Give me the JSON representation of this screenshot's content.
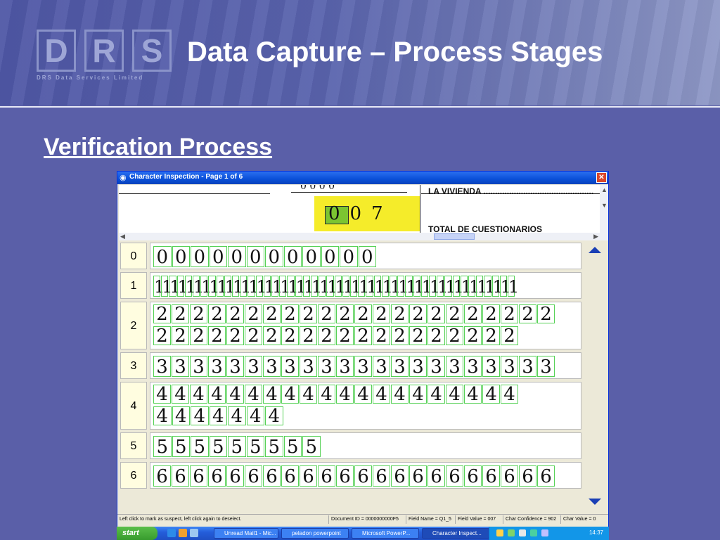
{
  "slide": {
    "title": "Data Capture – Process Stages",
    "subtitle": "Verification Process",
    "logo": {
      "letters": [
        "D",
        "R",
        "S"
      ],
      "tagline": "DRS Data Services Limited"
    }
  },
  "window": {
    "title": "Character Inspection - Page 1 of 6",
    "close_label": "✕",
    "preview": {
      "label_top": "LA VIVIENDA ...............................................",
      "label_bottom": "TOTAL  DE  CUESTIONARIOS",
      "handwritten_value": "007",
      "digits_top": "0 0 0 0"
    },
    "rows": [
      {
        "label": "0",
        "digit": "0",
        "lines": [
          12
        ]
      },
      {
        "label": "1",
        "digit": "1",
        "lines": [
          46
        ]
      },
      {
        "label": "2",
        "digit": "2",
        "lines": [
          22,
          20
        ]
      },
      {
        "label": "3",
        "digit": "3",
        "lines": [
          22
        ]
      },
      {
        "label": "4",
        "digit": "4",
        "lines": [
          20,
          7
        ]
      },
      {
        "label": "5",
        "digit": "5",
        "lines": [
          9
        ]
      },
      {
        "label": "6",
        "digit": "6",
        "lines": [
          22
        ]
      }
    ],
    "status": {
      "hint": "Left click to mark as suspect, left click again to deselect.",
      "document_id": "Document ID = 0000000000F5",
      "field_name": "Field Name = Q1_5",
      "field_value": "Field Value = 007",
      "char_confidence": "Char Confidence = 902",
      "char_value": "Char Value = 0"
    }
  },
  "taskbar": {
    "start_label": "start",
    "tasks": [
      {
        "label": "Unread Mail1 - Mic...",
        "active": false
      },
      {
        "label": "peladon powerpoint",
        "active": false
      },
      {
        "label": "Microsoft PowerP...",
        "active": false
      },
      {
        "label": "Character Inspect...",
        "active": true
      }
    ],
    "clock": "14:37"
  },
  "colors": {
    "slide_bg": "#5a5fa8",
    "cell_border": "#56d156",
    "titlebar": "#0a4fd8"
  }
}
